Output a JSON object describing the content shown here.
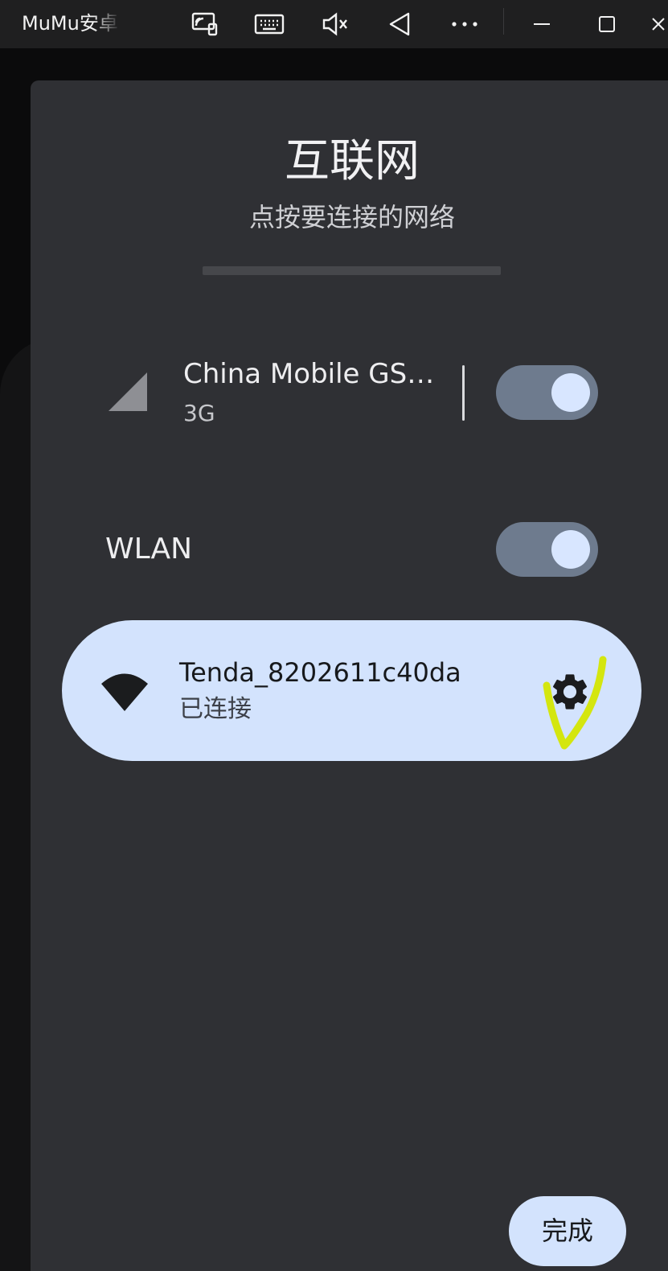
{
  "window": {
    "title": "MuMu安卓",
    "toolbar_icons": [
      "screen-cast-icon",
      "keyboard-icon",
      "mute-icon",
      "back-icon",
      "more-icon",
      "minimize-icon",
      "maximize-icon",
      "close-icon"
    ]
  },
  "dialog": {
    "title": "互联网",
    "subtitle": "点按要连接的网络",
    "mobile": {
      "name": "China Mobile GS…",
      "type": "3G",
      "toggle_on": true,
      "icon": "signal-icon"
    },
    "wlan": {
      "label": "WLAN",
      "toggle_on": true
    },
    "connected_network": {
      "ssid": "Tenda_8202611c40da",
      "status": "已连接",
      "icon": "wifi-icon",
      "settings_icon": "gear-icon"
    },
    "done_label": "完成"
  },
  "colors": {
    "sheet_bg": "#2f3034",
    "accent_card": "#d3e3fd",
    "toggle_track": "#6e7b8e",
    "toggle_knob": "#d8e6ff",
    "annotation_mark": "#d4e60f"
  }
}
